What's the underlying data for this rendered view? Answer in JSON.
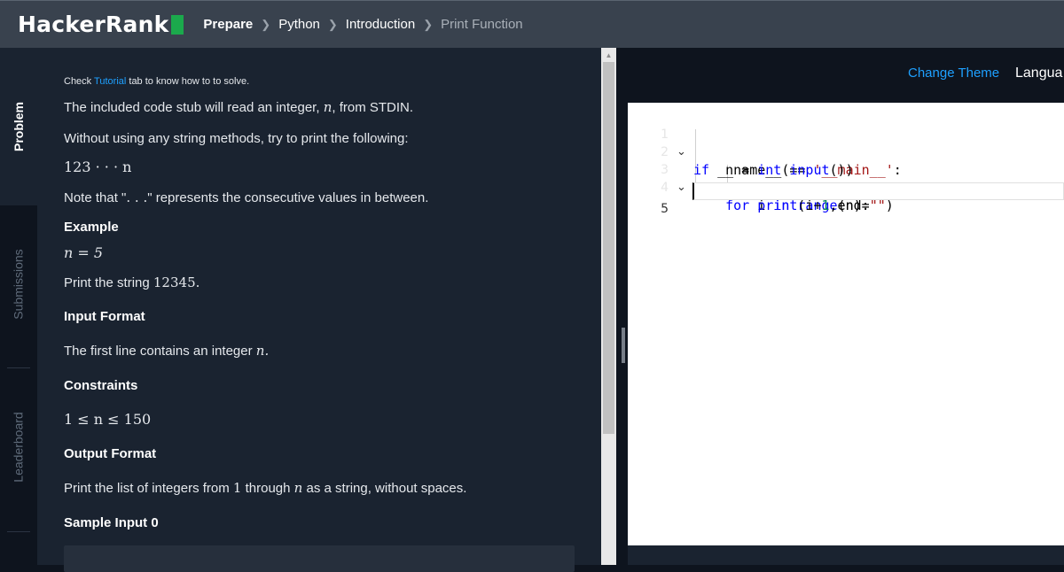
{
  "header": {
    "logo": "HackerRank",
    "breadcrumbs": [
      "Prepare",
      "Python",
      "Introduction",
      "Print Function"
    ]
  },
  "side_tabs": [
    "Problem",
    "Submissions",
    "Leaderboard"
  ],
  "problem": {
    "hint_prefix": "Check ",
    "hint_link": "Tutorial",
    "hint_suffix": " tab to know how to to solve.",
    "line1_prefix": "The included code stub will read an integer, ",
    "line1_var": "n",
    "line1_suffix": ", from STDIN.",
    "line2": "Without using any string methods, try to print the following:",
    "formula": "123 · · · n",
    "note_prefix": "Note that \"",
    "note_dots": ". . .",
    "note_suffix": "\" represents the consecutive values in between.",
    "example_heading": "Example",
    "example_eq": "n = 5",
    "example_print_prefix": "Print the string ",
    "example_print_value": "12345.",
    "input_format_heading": "Input Format",
    "input_format_prefix": "The first line contains an integer ",
    "input_format_var": "n.",
    "constraints_heading": "Constraints",
    "constraint": "1 ≤ n ≤ 150",
    "output_format_heading": "Output Format",
    "output_prefix": "Print the list of integers from ",
    "output_num": "1",
    "output_mid": " through ",
    "output_var": "n",
    "output_suffix": " as a string, without spaces.",
    "sample_input_heading": "Sample Input 0"
  },
  "editor": {
    "change_theme": "Change Theme",
    "language_label": "Langua",
    "line_numbers": [
      "1",
      "2",
      "3",
      "4",
      "5"
    ],
    "lines": [
      "if __name__ == '__main__':",
      "    n = int(input())",
      "    for i in range(n):",
      "        print(i+1,end=\"\")",
      ""
    ]
  },
  "colors": {
    "brand_green": "#1ba94c",
    "link_blue": "#1ea0ff",
    "nav_bg": "#39424e",
    "panel_bg": "#1a2330"
  }
}
